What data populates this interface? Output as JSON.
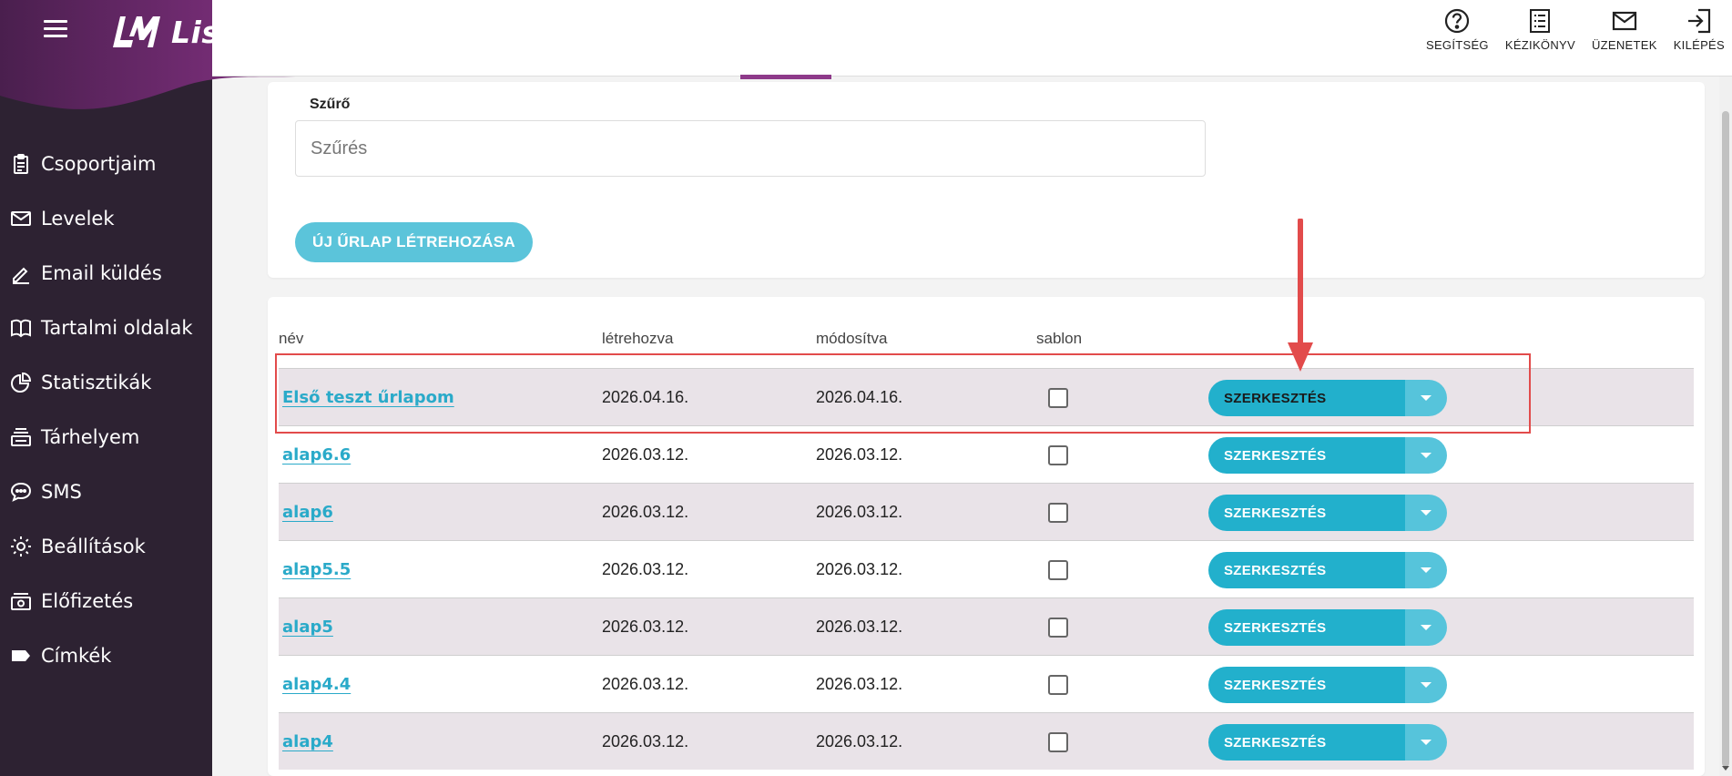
{
  "app": {
    "brand": "ListaMester",
    "accent_color": "#8e3a8a",
    "sidebar_bg": "#2d2232"
  },
  "sidebar": {
    "items": [
      {
        "label": "Csoportjaim",
        "icon": "clipboard-icon"
      },
      {
        "label": "Levelek",
        "icon": "envelope-icon"
      },
      {
        "label": "Email küldés",
        "icon": "pencil-icon"
      },
      {
        "label": "Tartalmi oldalak",
        "icon": "book-icon"
      },
      {
        "label": "Statisztikák",
        "icon": "pie-chart-icon"
      },
      {
        "label": "Tárhelyem",
        "icon": "storage-icon"
      },
      {
        "label": "SMS",
        "icon": "chat-icon"
      },
      {
        "label": "Beállítások",
        "icon": "gear-icon"
      },
      {
        "label": "Előfizetés",
        "icon": "money-icon"
      },
      {
        "label": "Címkék",
        "icon": "tag-icon"
      }
    ]
  },
  "topbar": {
    "links": [
      {
        "label": "SEGÍTSÉG",
        "icon": "help-icon"
      },
      {
        "label": "KÉZIKÖNYV",
        "icon": "manual-icon"
      },
      {
        "label": "ÜZENETEK",
        "icon": "mail-icon"
      },
      {
        "label": "KILÉPÉS",
        "icon": "logout-icon"
      }
    ]
  },
  "filter": {
    "label": "Szűrő",
    "placeholder": "Szűrés",
    "value": "",
    "new_button": "ÚJ ŰRLAP LÉTREHOZÁSA"
  },
  "table": {
    "headers": {
      "name": "név",
      "created": "létrehozva",
      "modified": "módosítva",
      "template": "sablon"
    },
    "edit_label": "SZERKESZTÉS",
    "rows": [
      {
        "name": "Első teszt űrlapom",
        "created": "2026.04.16.",
        "modified": "2026.04.16.",
        "template": false
      },
      {
        "name": "alap6.6",
        "created": "2026.03.12.",
        "modified": "2026.03.12.",
        "template": false
      },
      {
        "name": "alap6",
        "created": "2026.03.12.",
        "modified": "2026.03.12.",
        "template": false
      },
      {
        "name": "alap5.5",
        "created": "2026.03.12.",
        "modified": "2026.03.12.",
        "template": false
      },
      {
        "name": "alap5",
        "created": "2026.03.12.",
        "modified": "2026.03.12.",
        "template": false
      },
      {
        "name": "alap4.4",
        "created": "2026.03.12.",
        "modified": "2026.03.12.",
        "template": false
      },
      {
        "name": "alap4",
        "created": "2026.03.12.",
        "modified": "2026.03.12.",
        "template": false
      }
    ]
  },
  "annotation": {
    "color": "#e24b4b"
  }
}
